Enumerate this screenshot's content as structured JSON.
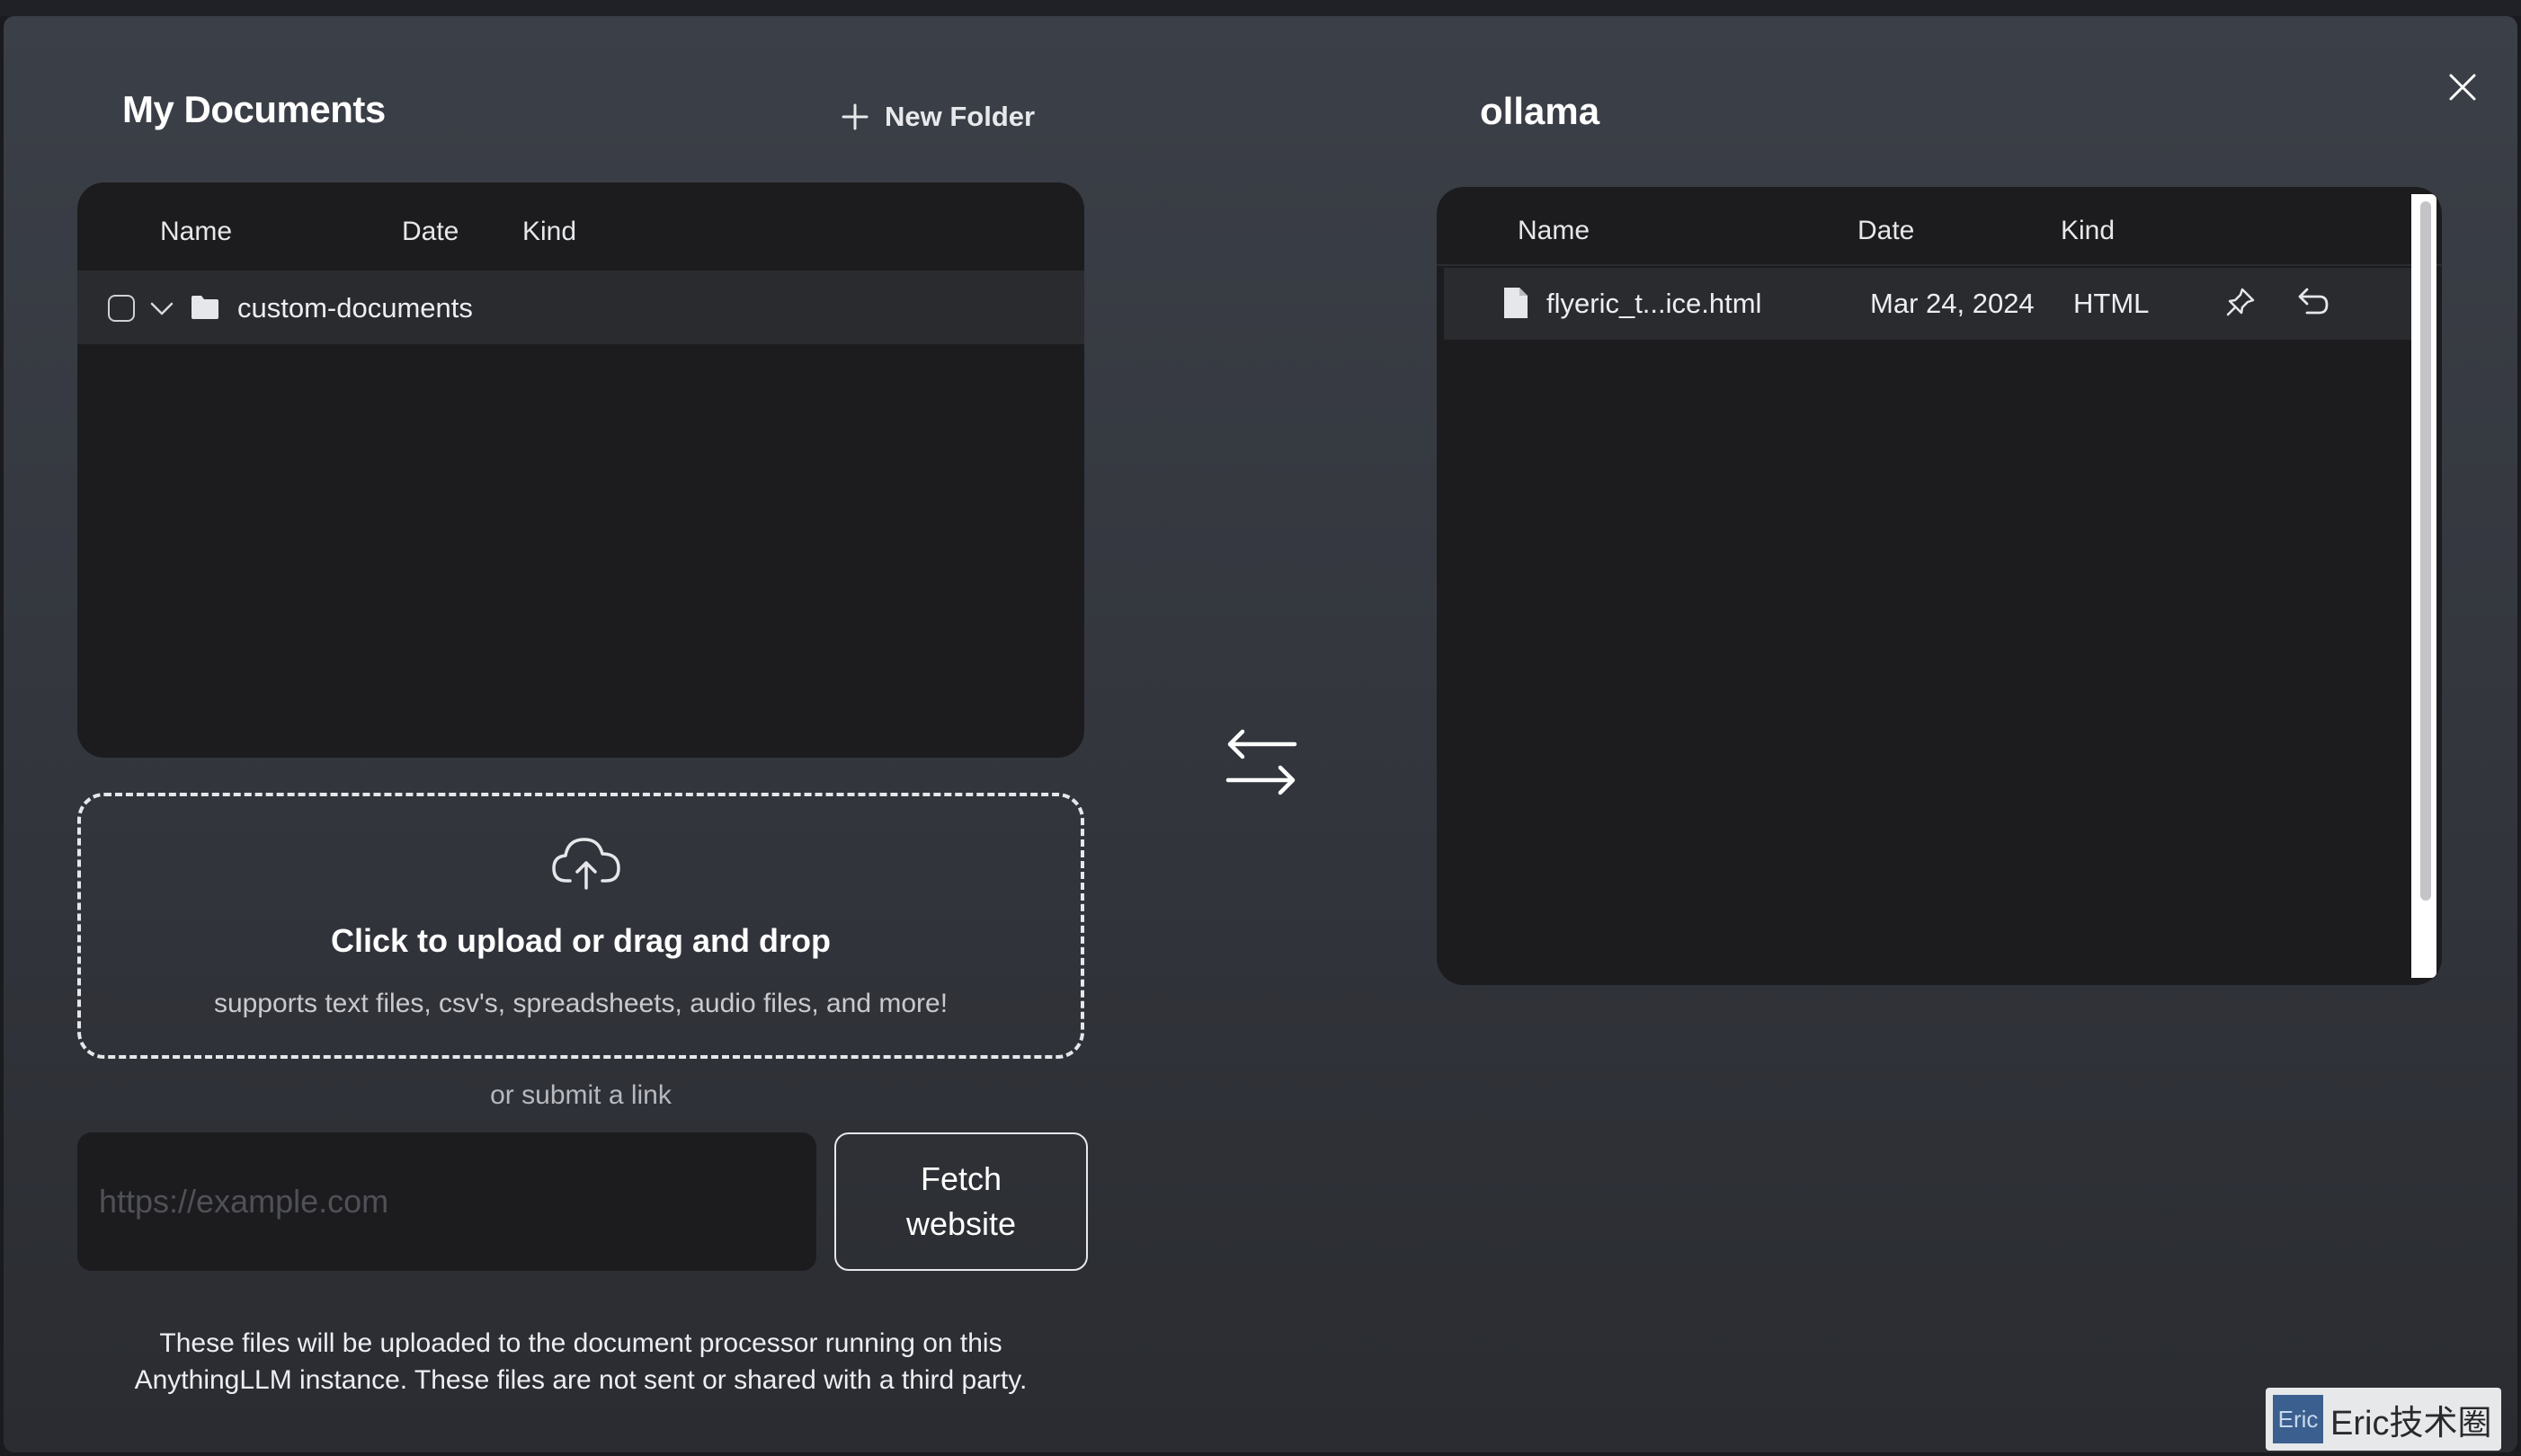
{
  "left_panel": {
    "title": "My Documents",
    "new_folder_label": "New Folder",
    "columns": [
      "Name",
      "Date",
      "Kind"
    ],
    "folders": [
      {
        "name": "custom-documents"
      }
    ]
  },
  "upload": {
    "title": "Click to upload or drag and drop",
    "subtitle": "supports text files, csv's, spreadsheets, audio files, and more!",
    "or_link": "or submit a link",
    "url_placeholder": "https://example.com",
    "fetch_label_line1": "Fetch",
    "fetch_label_line2": "website"
  },
  "disclaimer": {
    "line1": "These files will be uploaded to the document processor running on this",
    "line2": "AnythingLLM instance. These files are not sent or shared with a third party."
  },
  "right_panel": {
    "title": "ollama",
    "columns": [
      "Name",
      "Date",
      "Kind"
    ],
    "files": [
      {
        "name": "flyeric_t...ice.html",
        "date": "Mar 24, 2024",
        "kind": "HTML"
      }
    ]
  },
  "watermark": {
    "badge": "Eric",
    "text": "Eric技术圈"
  },
  "icons": {
    "close": "close-icon",
    "new_folder": "plus-icon",
    "chevron": "chevron-down-icon",
    "folder": "folder-icon",
    "cloud_upload": "cloud-upload-icon",
    "swap": "swap-arrows-icon",
    "file": "file-icon",
    "pin": "pin-icon",
    "undo": "undo-icon"
  },
  "colors": {
    "modal_bg": "#3b3f47",
    "panel_bg": "#1c1c1f",
    "row_bg": "#2a2b2f",
    "text": "#ffffff"
  }
}
